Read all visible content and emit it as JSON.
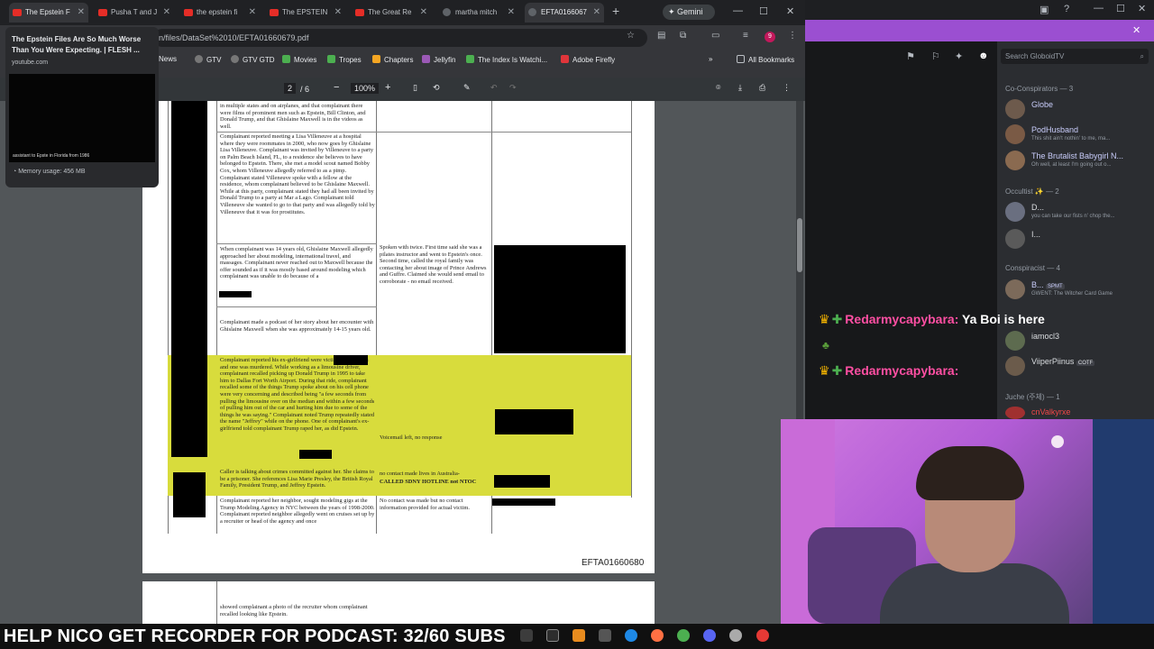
{
  "browser": {
    "tabs": [
      {
        "title": "The Epstein F",
        "type": "youtube"
      },
      {
        "title": "Pusha T and J",
        "type": "youtube"
      },
      {
        "title": "the epstein fi",
        "type": "youtube"
      },
      {
        "title": "The EPSTEIN",
        "type": "youtube"
      },
      {
        "title": "The Great Re",
        "type": "youtube"
      },
      {
        "title": "martha mitch",
        "type": "web"
      },
      {
        "title": "EFTA0166067",
        "type": "web"
      }
    ],
    "gemini_label": "Gemini",
    "url": "n/files/DataSet%2010/EFTA01660679.pdf",
    "profile_badge": "9",
    "bookmarks": [
      "News",
      "GTV",
      "GTV GTD",
      "Movies",
      "Tropes",
      "Chapters",
      "Jellyfin",
      "The Index Is Watchi...",
      "Adobe Firefly"
    ],
    "all_bookmarks_label": "All Bookmarks",
    "tab_preview": {
      "title": "The Epstein Files Are So Much Worse Than You Were Expecting. | FLESH ...",
      "site": "youtube.com",
      "thumb_caption": "assistant to Epste in Florida from 1986",
      "memory": "Memory usage: 456 MB"
    }
  },
  "pdf": {
    "page_current": "2",
    "page_total": "/ 6",
    "zoom": "100%",
    "rows": [
      {
        "complaint": "in multiple states and on airplanes, and that complainant there were films of prominent men such as Epstein, Bill Clinton, and Donald Trump, and that Ghislaine Maxwell is in the videos as well."
      },
      {
        "complaint": "Complainant reported meeting a Lisa Villeneuve at a hospital where they were roommates in 2000, who now goes by Ghislaine Lisa Villeneuve. Complainant was invited by Villeneuve to a party on Palm Beach Island, FL, to a residence she believes to have belonged to Epstein. There, she met a model scout named Bobby Cox, whom Villeneuve allegedly referred to as a pimp. Complainant stated Villeneuve spoke with a fellow at the residence, whom complainant believed to be Ghislaine Maxwell. While at this party, complainant stated they had all been invited by Donald Trump to a party at Mar a Lago. Complainant told Villeneuve she wanted to go to that party and was allegedly told by Villeneuve that it was for prostitutes."
      },
      {
        "complaint": "When complainant was 14 years old, Ghislaine Maxwell allegedly approached her about modeling, international travel, and massages. Complainant never reached out to Maxwell because the offer sounded as if it was mostly based around modeling which complainant was unable to do because of a",
        "followup": "Spoken with twice. First time said she was a pilates instructor and went to Epstein's once. Second time, called the royal family was contacting her about image of Prince Andrews and Guffre. Claimed she would send email to corroborate - no email received."
      },
      {
        "complaint": "Complainant made a podcast of her story about her encounter with Ghislaine Maxwell when she was approximately 14-15 years old."
      },
      {
        "complaint": "Complainant reported his ex-girlfriend were victims of Epstein's and one was murdered. While working as a limousine driver, complainant recalled picking up Donald Trump in 1995 to take him to Dallas Fort Worth Airport. During that ride, complainant recalled some of the things Trump spoke about on his cell phone were very concerning and described being \"a few seconds from pulling the limousine over on the median and within a few seconds of pulling him out of the car and hurting him due to some of the things he was saying.\" Complainant noted Trump repeatedly stated the name \"Jeffrey\" while on the phone. One of complainant's ex-girlfriend told complainant Trump raped her, as did Epstein.",
        "followup": "Voicemail left, no response"
      },
      {
        "complaint": "Caller is talking about crimes committed against her. She claims to be a prisoner. She references Lisa Marie Presley, the British Royal Family, President Trump, and Jeffrey Epstein.",
        "followup": "no contact made lives in Australia-",
        "followup_bold": "CALLED SDNY HOTLINE not NTOC"
      },
      {
        "complaint": "Complainant reported her neighbor, sought modeling gigs at the Trump Modeling Agency in NYC between the years of 1998-2000. Complainant reported neighbor allegedly went on cruises set up by a recruiter or head of the agency and once",
        "followup": "No contact was made but no contact information provided for actual victim."
      }
    ],
    "footer_id": "EFTA01660680",
    "page2_text": "showed complainant a photo of the recruiter whom complainant recalled looking like Epstein."
  },
  "discord": {
    "search_placeholder": "Search GloboidTV",
    "groups": [
      {
        "label": "Co-Conspirators — 3",
        "members": [
          {
            "name": "Globe",
            "status": ""
          },
          {
            "name": "PodHusband",
            "status": "This shit ain't nothin' to me, ma..."
          },
          {
            "name": "The Brutalist Babygirl N...",
            "status": "Oh well, at least I'm going out o..."
          }
        ]
      },
      {
        "label": "Occultist ✨ — 2",
        "members": [
          {
            "name": "D...",
            "status": "you can take our fists n' chop the..."
          },
          {
            "name": "I...",
            "status": ""
          }
        ]
      },
      {
        "label": "Conspiracist — 4",
        "members": [
          {
            "name": "B...",
            "badge": "SPMT",
            "status": "GWENT: The Witcher Card Game"
          },
          {
            "name": "iamocl3",
            "status": ""
          },
          {
            "name": "ViiperPiinus",
            "badge": "COTF",
            "status": ""
          }
        ]
      },
      {
        "label": "Juche (주체) — 1",
        "members": [
          {
            "name": "cnValkyrxe",
            "status": ""
          }
        ]
      }
    ]
  },
  "chat": [
    {
      "user": "Redarmycapybara:",
      "message": "Ya Boi is here"
    },
    {
      "user": "",
      "message": ""
    },
    {
      "user": "Redarmycapybara:",
      "message": ""
    }
  ],
  "ticker": "HELP NICO GET RECORDER FOR PODCAST: 32/60 SUBS",
  "colors": {
    "accent_purple": "#9b4fd1",
    "highlight_yellow": "#d8dc3c",
    "chat_user": "#ff4fa3"
  }
}
